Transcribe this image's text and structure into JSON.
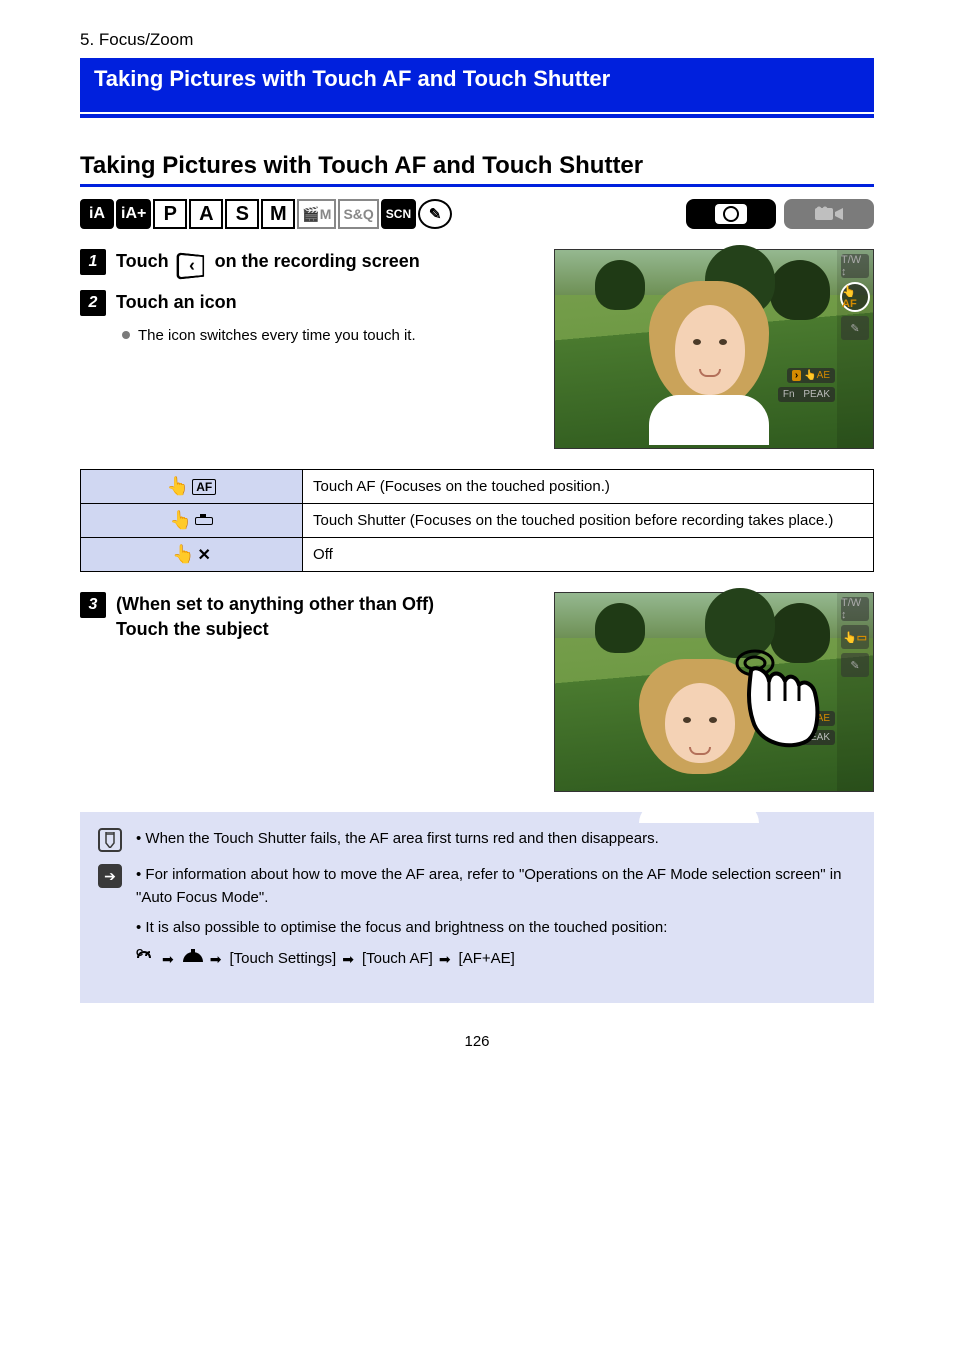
{
  "category": "5. Focus/Zoom",
  "header_title": "Taking Pictures with Touch AF and Touch Shutter",
  "section_title": "Taking Pictures with Touch AF and Touch Shutter",
  "mode_icons": [
    "iA",
    "iA+",
    "P",
    "A",
    "S",
    "M",
    "🎬M",
    "S&Q",
    "SCN",
    "✎"
  ],
  "steps": {
    "one": {
      "text_before": "Touch ",
      "tab_glyph": "‹",
      "text_after": " on the recording screen"
    },
    "two": {
      "main": "Touch an icon",
      "sub": "The icon switches every time you touch it."
    }
  },
  "table": {
    "row1": {
      "suffix": "AF",
      "desc": "Touch AF (Focuses on the touched position.)"
    },
    "row2": {
      "suffix_shape": "shutter",
      "desc": "Touch Shutter (Focuses on the touched position before recording takes place.)"
    },
    "row3": {
      "suffix_shape": "x",
      "desc": "Off"
    }
  },
  "step3": {
    "main": "(When set to anything other than Off)",
    "bold": "Touch the subject"
  },
  "notes": {
    "pencil": "When the Touch Shutter fails, the AF area first turns red and then disappears.",
    "arrow_text1": "For information about how to move the AF area, refer to \"Operations on the AF Mode selection screen\" in \"Auto Focus Mode\".",
    "arrow_text2": "It is also possible to optimise the focus and brightness on the touched position:",
    "menu_path": {
      "seg1": "[Touch Settings]",
      "seg2": "[Touch AF]",
      "seg3": "[AF+AE]"
    }
  },
  "strip": {
    "zoom": "T/W ↕",
    "af": "👆AF",
    "draw": "✎",
    "ae": "👆AE",
    "fn": "Fn",
    "peak": "PEAK"
  },
  "page_number": "126"
}
